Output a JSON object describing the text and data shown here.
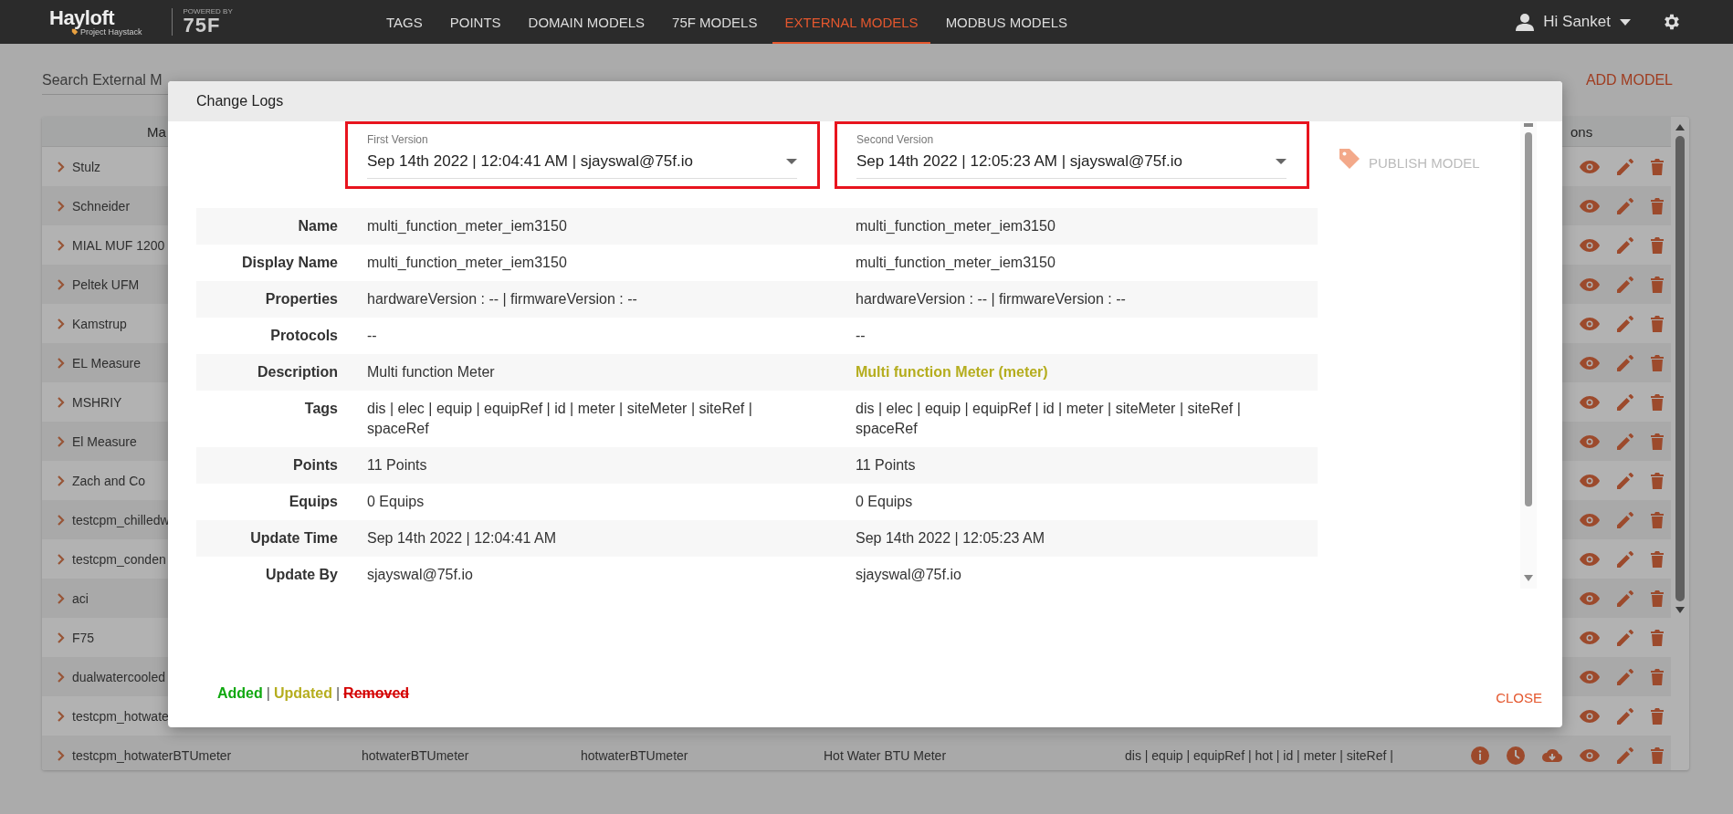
{
  "header": {
    "logo": {
      "name": "Hayloft",
      "tagline": "Project Haystack",
      "powered_by": "POWERED BY",
      "brand": "75F"
    },
    "nav": [
      {
        "label": "TAGS",
        "selected": false
      },
      {
        "label": "POINTS",
        "selected": false
      },
      {
        "label": "DOMAIN MODELS",
        "selected": false
      },
      {
        "label": "75F MODELS",
        "selected": false
      },
      {
        "label": "EXTERNAL MODELS",
        "selected": true
      },
      {
        "label": "MODBUS MODELS",
        "selected": false
      }
    ],
    "user": {
      "greeting": "Hi Sanket"
    }
  },
  "page": {
    "search": {
      "placeholder": "Search External M"
    },
    "add_button": "ADD MODEL",
    "table": {
      "columns": [
        "Ma",
        "ons"
      ],
      "rows": [
        {
          "name": "Stulz",
          "kind": "plain"
        },
        {
          "name": "Schneider",
          "kind": "plain"
        },
        {
          "name": "MIAL MUF 1200",
          "kind": "plain"
        },
        {
          "name": "Peltek UFM",
          "kind": "plain"
        },
        {
          "name": "Kamstrup",
          "kind": "plain"
        },
        {
          "name": "EL Measure",
          "kind": "plain"
        },
        {
          "name": "MSHRIY",
          "kind": "plain"
        },
        {
          "name": "El Measure",
          "kind": "plain"
        },
        {
          "name": "Zach and Co",
          "kind": "plain"
        },
        {
          "name": "testcpm_chilledw",
          "kind": "plain"
        },
        {
          "name": "testcpm_conden",
          "kind": "plain"
        },
        {
          "name": "aci",
          "kind": "plain"
        },
        {
          "name": "F75",
          "kind": "plain"
        },
        {
          "name": "dualwatercooled",
          "kind": "plain"
        },
        {
          "name": "testcpm_hotwate",
          "kind": "plain"
        },
        {
          "name": "testcpm_hotwaterBTUmeter",
          "cells": [
            "hotwaterBTUmeter",
            "hotwaterBTUmeter",
            "Hot Water BTU Meter",
            "dis | equip | equipRef | hot | id | meter | siteRef |"
          ],
          "kind": "detailed"
        }
      ]
    }
  },
  "modal": {
    "title": "Change Logs",
    "versions": [
      {
        "label": "First Version",
        "value": "Sep 14th 2022 | 12:04:41 AM | sjayswal@75f.io",
        "highlighted": true
      },
      {
        "label": "Second Version",
        "value": "Sep 14th 2022 | 12:05:23 AM | sjayswal@75f.io",
        "highlighted": true
      }
    ],
    "publish": {
      "label": "PUBLISH MODEL",
      "disabled": true
    },
    "rows": [
      {
        "label": "Name",
        "first": {
          "text": "multi_function_meter_iem3150",
          "kind": "unchanged"
        },
        "second": {
          "text": "multi_function_meter_iem3150",
          "kind": "unchanged"
        }
      },
      {
        "label": "Display Name",
        "first": {
          "text": "multi_function_meter_iem3150",
          "kind": "unchanged"
        },
        "second": {
          "text": "multi_function_meter_iem3150",
          "kind": "unchanged"
        }
      },
      {
        "label": "Properties",
        "first": {
          "text": "hardwareVersion : -- | firmwareVersion : --",
          "kind": "unchanged"
        },
        "second": {
          "text": "hardwareVersion : -- | firmwareVersion : --",
          "kind": "unchanged"
        }
      },
      {
        "label": "Protocols",
        "first": {
          "text": "--",
          "kind": "unchanged"
        },
        "second": {
          "text": "--",
          "kind": "unchanged"
        }
      },
      {
        "label": "Description",
        "first": {
          "text": "Multi function Meter",
          "kind": "unchanged"
        },
        "second": {
          "text": "Multi function Meter (meter)",
          "kind": "updated"
        }
      },
      {
        "label": "Tags",
        "first": {
          "text": "dis | elec | equip | equipRef | id | meter | siteMeter | siteRef | spaceRef",
          "kind": "unchanged"
        },
        "second": {
          "text": "dis | elec | equip | equipRef | id | meter | siteMeter | siteRef | spaceRef",
          "kind": "unchanged"
        }
      },
      {
        "label": "Points",
        "first": {
          "text": "11 Points",
          "kind": "unchanged"
        },
        "second": {
          "text": "11 Points",
          "kind": "unchanged"
        }
      },
      {
        "label": "Equips",
        "first": {
          "text": "0 Equips",
          "kind": "unchanged"
        },
        "second": {
          "text": "0 Equips",
          "kind": "unchanged"
        }
      },
      {
        "label": "Update Time",
        "first": {
          "text": "Sep 14th 2022 | 12:04:41 AM",
          "kind": "unchanged"
        },
        "second": {
          "text": "Sep 14th 2022 | 12:05:23 AM",
          "kind": "unchanged"
        }
      },
      {
        "label": "Update By",
        "first": {
          "text": "sjayswal@75f.io",
          "kind": "unchanged"
        },
        "second": {
          "text": "sjayswal@75f.io",
          "kind": "unchanged"
        }
      }
    ],
    "legend": {
      "separator": "|",
      "items": [
        {
          "label": "Added",
          "kind": "added"
        },
        {
          "label": "Updated",
          "kind": "updated"
        },
        {
          "label": "Removed",
          "kind": "removed"
        }
      ]
    },
    "close": "CLOSE"
  }
}
